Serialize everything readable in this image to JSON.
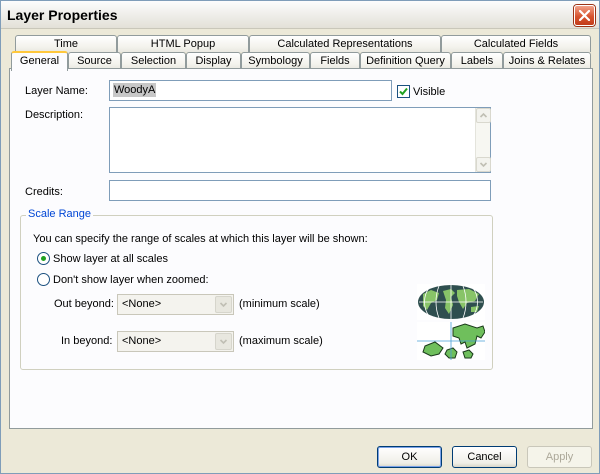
{
  "window": {
    "title": "Layer Properties"
  },
  "tabs": {
    "row1": [
      "Time",
      "HTML Popup",
      "Calculated Representations",
      "Calculated Fields"
    ],
    "row2": [
      "General",
      "Source",
      "Selection",
      "Display",
      "Symbology",
      "Fields",
      "Definition Query",
      "Labels",
      "Joins & Relates"
    ],
    "active": "General"
  },
  "general": {
    "layer_name_label": "Layer Name:",
    "layer_name_value": "WoodyA",
    "visible_label": "Visible",
    "visible_checked": true,
    "description_label": "Description:",
    "description_value": "",
    "credits_label": "Credits:",
    "credits_value": ""
  },
  "scale_range": {
    "title": "Scale Range",
    "instruction": "You can specify the range of scales at which this layer will be shown:",
    "option_all": "Show layer at all scales",
    "option_zoomed": "Don't show layer when zoomed:",
    "selected_option": "option_all",
    "out_beyond_label": "Out beyond:",
    "out_beyond_value": "<None>",
    "out_beyond_note": "(minimum scale)",
    "in_beyond_label": "In beyond:",
    "in_beyond_value": "<None>",
    "in_beyond_note": "(maximum scale)",
    "icon_min": "world-globe-icon",
    "icon_max": "zoomed-map-icon"
  },
  "buttons": {
    "ok": "OK",
    "cancel": "Cancel",
    "apply": "Apply"
  },
  "colors": {
    "active_tab_accent": "#ffc83c",
    "group_title": "#0046d5",
    "dialog_bg": "#ece9d8"
  }
}
